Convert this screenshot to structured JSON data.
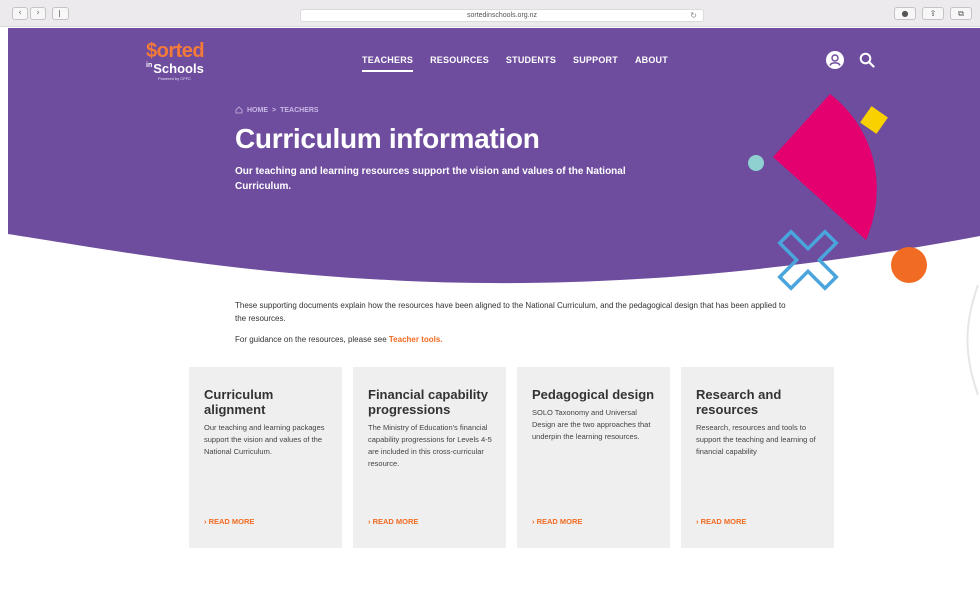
{
  "browser": {
    "url": "sortedinschools.org.nz",
    "back_glyph": "‹",
    "forward_glyph": "›"
  },
  "logo": {
    "sorted": "$orted",
    "in": "in",
    "schools": "Schools",
    "powered": "Powered by CFFC"
  },
  "nav": {
    "items": [
      "TEACHERS",
      "RESOURCES",
      "STUDENTS",
      "SUPPORT",
      "ABOUT"
    ],
    "active": "TEACHERS"
  },
  "breadcrumb": {
    "home": "HOME",
    "separator": ">",
    "current": "TEACHERS"
  },
  "hero": {
    "title": "Curriculum information",
    "subtitle": "Our teaching and learning resources support the vision and values of the National Curriculum."
  },
  "intro": {
    "text": "These supporting documents explain how the resources have been aligned to the National Curriculum, and the pedagogical design that has been applied to the resources.",
    "guidance_prefix": "For guidance on the resources, please see ",
    "guidance_link": "Teacher tools."
  },
  "cards": [
    {
      "title": "Curriculum alignment",
      "body": "Our teaching and learning packages support the vision and values of the National Curriculum.",
      "link": "READ MORE"
    },
    {
      "title": "Financial capability progressions",
      "body": "The Ministry of Education's financial capability progressions for Levels 4-5 are included in this cross-curricular resource.",
      "link": "READ MORE"
    },
    {
      "title": "Pedagogical design",
      "body": "SOLO Taxonomy and Universal Design are the two approaches that underpin the learning resources.",
      "link": "READ MORE"
    },
    {
      "title": "Research and resources",
      "body": "Research, resources and tools to support the teaching and learning of financial capability",
      "link": "READ MORE"
    }
  ],
  "colors": {
    "purple": "#6e4c9e",
    "orange": "#f26b22",
    "magenta": "#e5006f",
    "yellow": "#f9d100",
    "teal": "#8fd1d0",
    "blue": "#4aa5dc"
  }
}
